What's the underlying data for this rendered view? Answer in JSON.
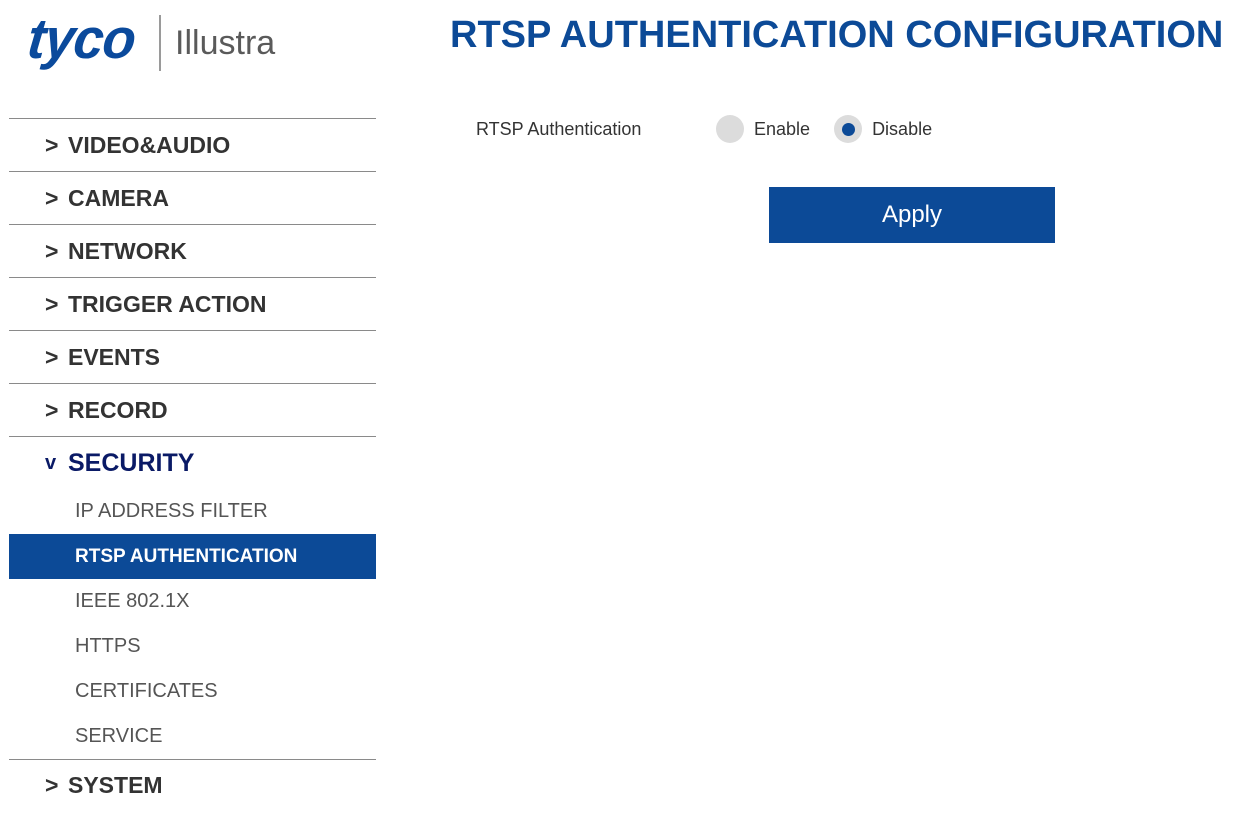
{
  "logo": {
    "brand": "tyco",
    "product": "Illustra"
  },
  "page": {
    "title": "RTSP AUTHENTICATION CONFIGURATION"
  },
  "sidebar": {
    "items": [
      {
        "chevron": ">",
        "label": "VIDEO&AUDIO"
      },
      {
        "chevron": ">",
        "label": "CAMERA"
      },
      {
        "chevron": ">",
        "label": "NETWORK"
      },
      {
        "chevron": ">",
        "label": "TRIGGER ACTION"
      },
      {
        "chevron": ">",
        "label": "EVENTS"
      },
      {
        "chevron": ">",
        "label": "RECORD"
      },
      {
        "chevron": "v",
        "label": "SECURITY",
        "expanded": true,
        "subitems": [
          {
            "label": "IP ADDRESS FILTER"
          },
          {
            "label": "RTSP AUTHENTICATION",
            "active": true
          },
          {
            "label": "IEEE 802.1X"
          },
          {
            "label": "HTTPS"
          },
          {
            "label": "CERTIFICATES"
          },
          {
            "label": "SERVICE"
          }
        ]
      },
      {
        "chevron": ">",
        "label": "SYSTEM"
      }
    ]
  },
  "form": {
    "rtsp_auth": {
      "label": "RTSP Authentication",
      "options": [
        {
          "label": "Enable",
          "selected": false
        },
        {
          "label": "Disable",
          "selected": true
        }
      ]
    },
    "apply_label": "Apply"
  },
  "colors": {
    "brand_blue": "#0c4a97",
    "expanded_heading": "#0a1a66",
    "radio_unselected": "#dcdcdc"
  }
}
